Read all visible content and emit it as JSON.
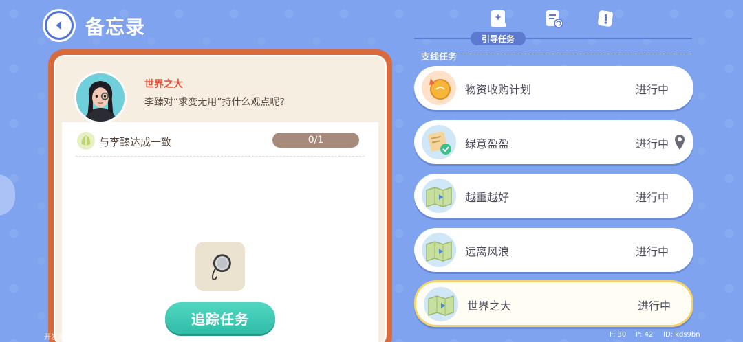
{
  "header": {
    "title": "备忘录"
  },
  "tabs": {
    "active_label": "引导任务",
    "icons": [
      "guide-book-icon",
      "clipboard-refresh-icon",
      "note-exclaim-icon"
    ]
  },
  "section": {
    "label": "支线任务"
  },
  "detail": {
    "name": "世界之大",
    "description": "李臻对“求变无用”持什么观点呢?",
    "objective": "与李臻达成一致",
    "progress": "0/1",
    "track_button": "追踪任务"
  },
  "quests": [
    {
      "title": "物资收购计划",
      "status": "进行中",
      "icon": "gold-coin-icon"
    },
    {
      "title": "绿意盈盈",
      "status": "进行中",
      "icon": "notepad-check-icon",
      "pinned": true
    },
    {
      "title": "越重越好",
      "status": "进行中",
      "icon": "map-icon"
    },
    {
      "title": "远离风浪",
      "status": "进行中",
      "icon": "map-icon"
    },
    {
      "title": "世界之大",
      "status": "进行中",
      "icon": "map-icon",
      "selected": true
    }
  ],
  "footer": {
    "dev_note": "开发测试版本，不代表游戏最终品质",
    "fps": "F: 30",
    "ping": "P: 42",
    "id": "ID: kds9bn"
  },
  "colors": {
    "background": "#7fa3ee",
    "panel_frame": "#d96a3c",
    "accent_teal": "#2fbda8",
    "quest_name": "#e8513b"
  }
}
